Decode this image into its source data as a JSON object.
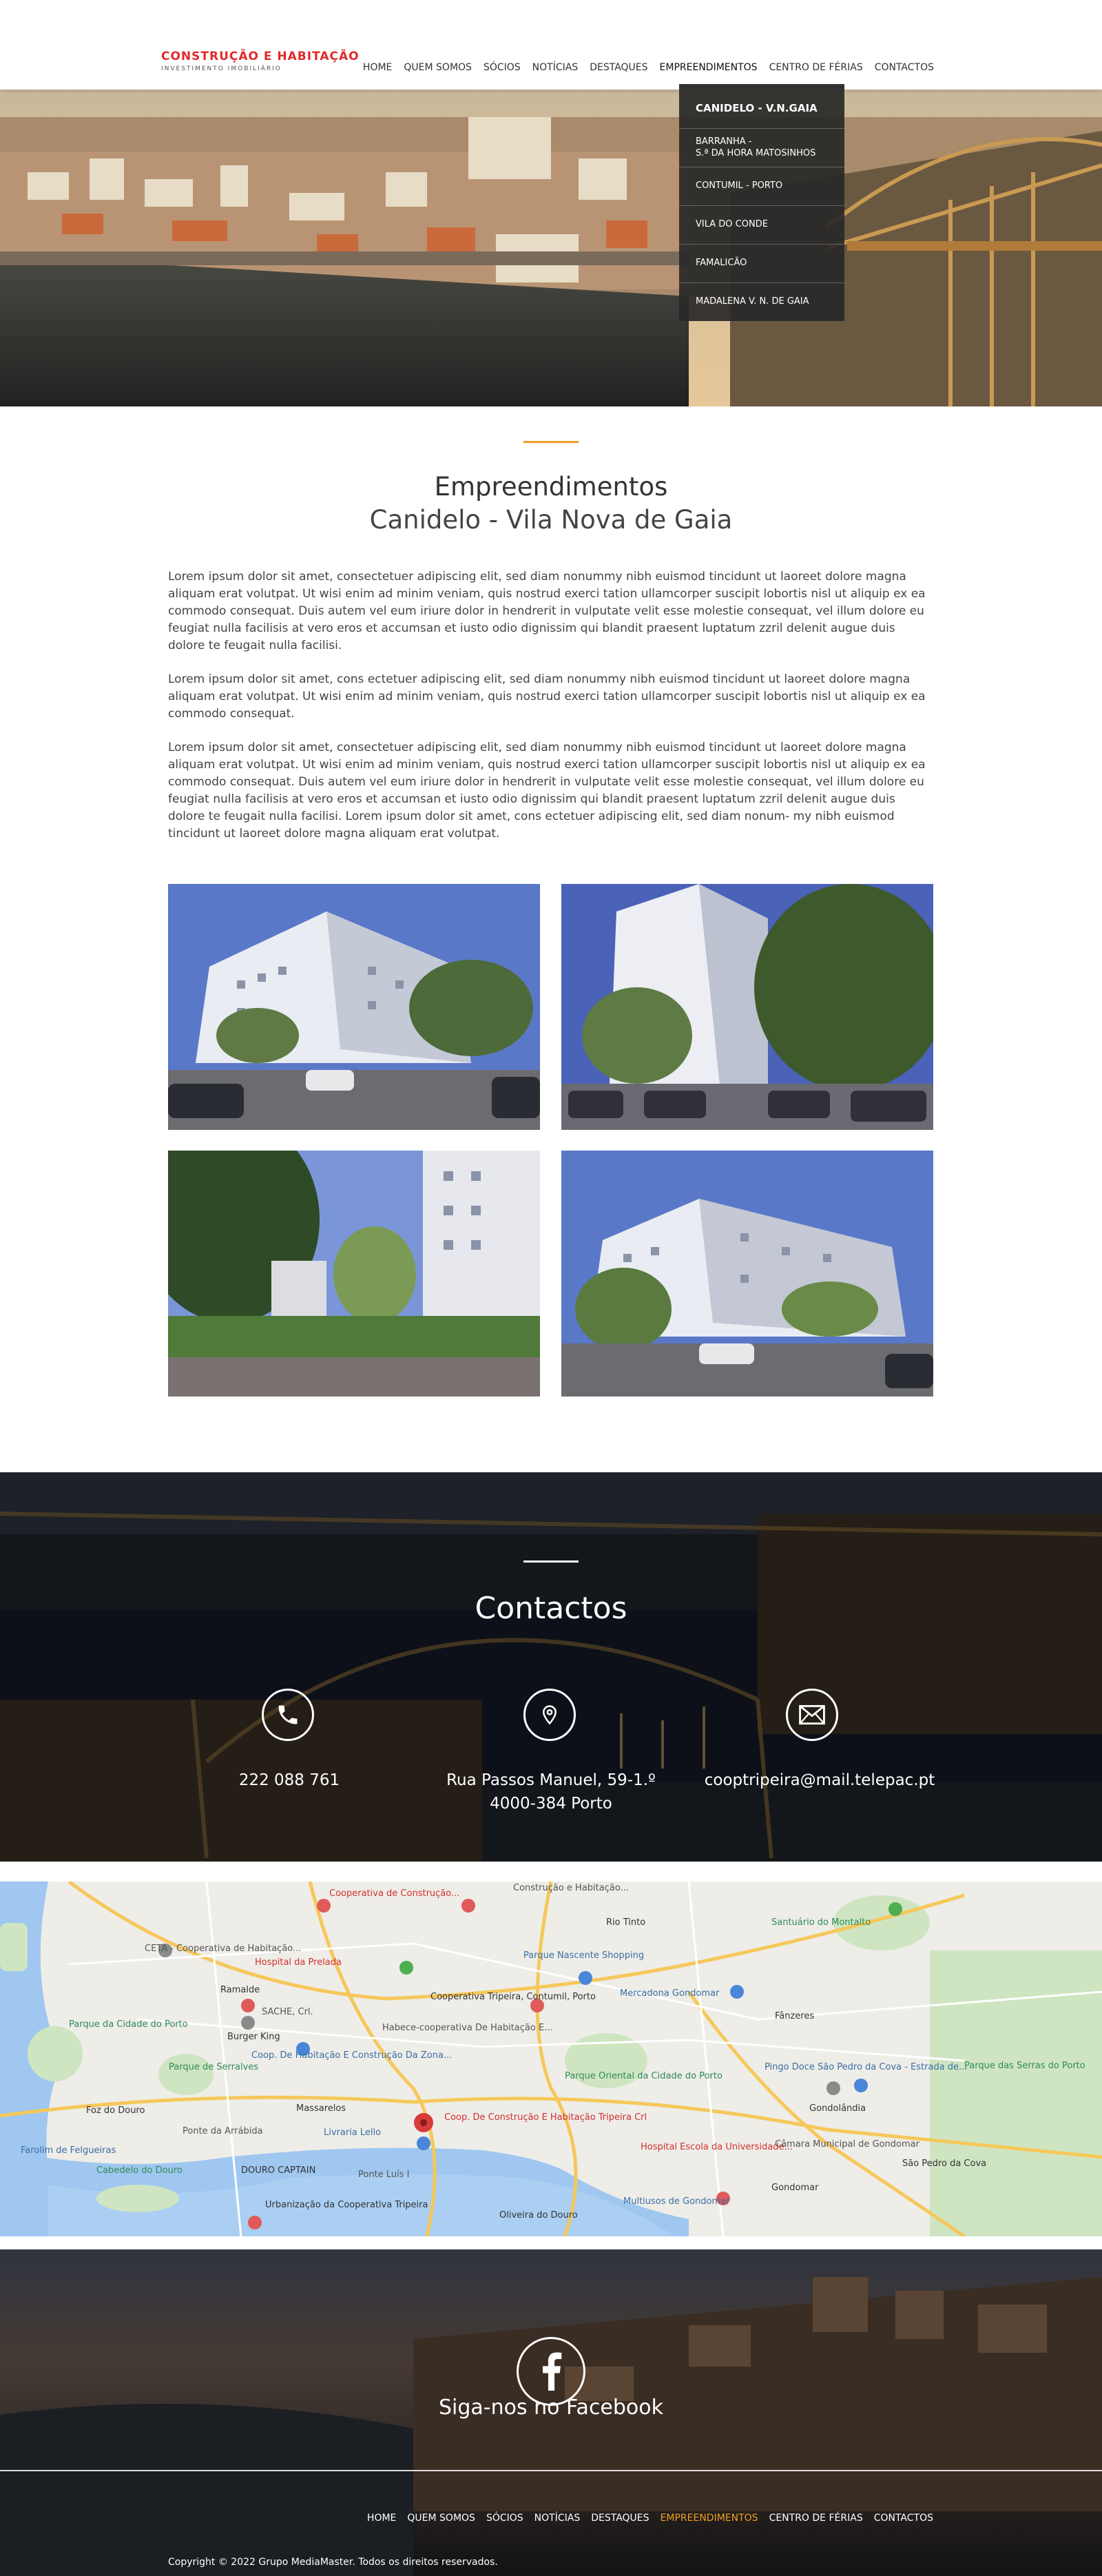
{
  "brand": {
    "title": "Construção e Habitação",
    "subtitle": "Investimento Imobiliário",
    "accent_color": "#e02a2a"
  },
  "nav": {
    "items": [
      {
        "label": "HOME"
      },
      {
        "label": "QUEM SOMOS"
      },
      {
        "label": "SÓCIOS"
      },
      {
        "label": "NOTÍCIAS"
      },
      {
        "label": "DESTAQUES"
      },
      {
        "label": "EMPREENDIMENTOS",
        "active": true
      },
      {
        "label": "CENTRO DE FÉRIAS"
      },
      {
        "label": "CONTACTOS"
      }
    ]
  },
  "dropdown": {
    "items": [
      {
        "label": "CANIDELO - V.N.GAIA",
        "line2": ""
      },
      {
        "label": "BARRANHA -",
        "line2": "S.ª DA HORA MATOSINHOS"
      },
      {
        "label": "CONTUMIL - PORTO",
        "line2": ""
      },
      {
        "label": "VILA DO CONDE",
        "line2": ""
      },
      {
        "label": "FAMALICÃO",
        "line2": ""
      },
      {
        "label": "MADALENA V. N. DE GAIA",
        "line2": ""
      }
    ]
  },
  "content": {
    "title": "Empreendimentos",
    "subtitle": "Canidelo - Vila Nova de Gaia",
    "accent_color": "#f0a020",
    "paragraphs": [
      "Lorem ipsum dolor sit amet, consectetuer adipiscing elit, sed diam nonummy nibh euismod tincidunt ut laoreet dolore magna aliquam erat volutpat. Ut wisi enim ad minim veniam, quis nostrud exerci tation ullamcorper suscipit lobortis nisl ut aliquip ex ea commodo consequat. Duis autem vel eum iriure dolor in hendrerit in vulputate velit esse molestie consequat, vel illum dolore eu feugiat nulla facilisis at vero eros et accumsan et iusto odio dignissim qui blandit praesent luptatum zzril delenit augue duis dolore te feugait nulla facilisi.",
      "Lorem ipsum dolor sit amet, cons ectetuer adipiscing elit, sed diam nonummy nibh euismod tincidunt ut laoreet dolore magna aliquam erat volutpat. Ut wisi enim ad minim veniam, quis nostrud exerci tation ullamcorper suscipit lobortis nisl ut aliquip ex ea commodo consequat.",
      "Lorem ipsum dolor sit amet, consectetuer adipiscing elit, sed diam nonummy nibh euismod tincidunt ut laoreet dolore magna aliquam erat volutpat. Ut wisi enim ad minim veniam, quis nostrud exerci tation ullamcorper suscipit lobortis nisl ut aliquip ex ea commodo consequat. Duis autem vel eum iriure dolor in hendrerit in vulputate velit esse molestie consequat, vel illum dolore eu feugiat nulla facilisis at vero eros et accumsan et iusto odio dignissim qui blandit praesent luptatum zzril delenit augue duis dolore te feugait nulla facilisi. Lorem ipsum dolor sit amet, cons ectetuer adipiscing elit, sed diam nonum- my nibh euismod tincidunt ut laoreet dolore magna aliquam erat volutpat."
    ]
  },
  "contacts": {
    "title": "Contactos",
    "phone": "222 088 761",
    "address_line1": "Rua Passos Manuel, 59-1.º",
    "address_line2": "4000-384 Porto",
    "email": "cooptripeira@mail.telepac.pt"
  },
  "map": {
    "labels": [
      {
        "text": "Cooperativa de Construção...",
        "kind": "red"
      },
      {
        "text": "Construção e Habitação...",
        "kind": "plain"
      },
      {
        "text": "Rio Tinto",
        "kind": "dark"
      },
      {
        "text": "Santuário do Montalto",
        "kind": "green"
      },
      {
        "text": "CETA - Cooperativa de Habitação...",
        "kind": "plain"
      },
      {
        "text": "Hospital da Prelada",
        "kind": "red"
      },
      {
        "text": "Parque Nascente Shopping",
        "kind": "blue"
      },
      {
        "text": "Parque da Cidade do Porto",
        "kind": "green"
      },
      {
        "text": "Ramalde",
        "kind": "dark"
      },
      {
        "text": "SACHE, Crl.",
        "kind": "plain"
      },
      {
        "text": "Cooperativa Tripeira, Contumil, Porto",
        "kind": "dark"
      },
      {
        "text": "Mercadona Gondomar",
        "kind": "blue"
      },
      {
        "text": "Burger King",
        "kind": "dark"
      },
      {
        "text": "Habece-cooperativa De Habitação E...",
        "kind": "plain"
      },
      {
        "text": "Fânzeres",
        "kind": "dark"
      },
      {
        "text": "Coop. De Habitação E Construção Da Zona...",
        "kind": "blue"
      },
      {
        "text": "Parque de Serralves",
        "kind": "green"
      },
      {
        "text": "Parque Oriental da Cidade do Porto",
        "kind": "green"
      },
      {
        "text": "Pingo Doce São Pedro da Cova - Estrada de...",
        "kind": "blue"
      },
      {
        "text": "Parque das Serras do Porto",
        "kind": "green"
      },
      {
        "text": "Foz do Douro",
        "kind": "dark"
      },
      {
        "text": "Massarelos",
        "kind": "dark"
      },
      {
        "text": "Coop. De Construção E Habitação Tripeira Crl",
        "kind": "red"
      },
      {
        "text": "Gondolândia",
        "kind": "dark"
      },
      {
        "text": "Farolim de Felgueiras",
        "kind": "blue"
      },
      {
        "text": "Ponte da Arrábida",
        "kind": "plain"
      },
      {
        "text": "Livraria Lello",
        "kind": "blue"
      },
      {
        "text": "Hospital Escola da Universidade...",
        "kind": "red"
      },
      {
        "text": "Câmara Municipal de Gondomar",
        "kind": "plain"
      },
      {
        "text": "Cabedelo do Douro",
        "kind": "green"
      },
      {
        "text": "DOURO CAPTAIN",
        "kind": "dark"
      },
      {
        "text": "Ponte Luís I",
        "kind": "plain"
      },
      {
        "text": "Gondomar",
        "kind": "dark"
      },
      {
        "text": "São Pedro da Cova",
        "kind": "dark"
      },
      {
        "text": "Urbanização da Cooperativa Tripeira",
        "kind": "dark"
      },
      {
        "text": "Oliveira do Douro",
        "kind": "dark"
      },
      {
        "text": "Multiusos de Gondomar",
        "kind": "blue"
      }
    ]
  },
  "footer": {
    "facebook_text": "Siga-nos no Facebook",
    "nav": [
      {
        "label": "HOME"
      },
      {
        "label": "QUEM SOMOS"
      },
      {
        "label": "SÓCIOS"
      },
      {
        "label": "NOTÍCIAS"
      },
      {
        "label": "DESTAQUES"
      },
      {
        "label": "EMPREENDIMENTOS",
        "active": true
      },
      {
        "label": "CENTRO DE FÉRIAS"
      },
      {
        "label": "CONTACTOS"
      }
    ],
    "copyright": "Copyright © 2022 Grupo MediaMaster. Todos os direitos reservados.",
    "active_color": "#f0a020"
  }
}
